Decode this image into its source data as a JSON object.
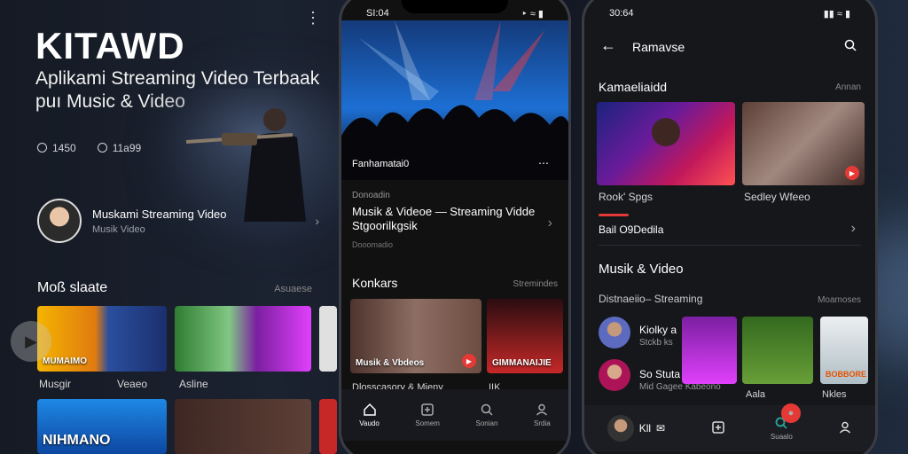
{
  "banner": {
    "title": "KITAWD",
    "subtitle": "Aplikami Streaming Video Terbaak puı Music & Video",
    "stats": [
      "1450",
      "11a99"
    ],
    "channel": {
      "name": "Muskami Streaming Video",
      "meta": "Musik Video"
    },
    "section": {
      "title": "Moß slaate",
      "more": "Asuaese"
    },
    "thumbs": [
      {
        "label": "MUMAIMO",
        "caption": "Musgir"
      },
      {
        "label": "",
        "caption": "Veaeo"
      },
      {
        "label": "",
        "caption": "Asline"
      },
      {
        "label": "",
        "caption": ""
      },
      {
        "label": "NIHMANO",
        "caption": ""
      }
    ]
  },
  "phone1": {
    "time": "SI:04",
    "hero_label": "Fanhamatai0",
    "meta_small": "Donoadin",
    "video_title": "Musik & Videoe — Streaming Vidde Stgoorilkgsik",
    "meta_small2": "Dooomadio",
    "section": {
      "title": "Konkars",
      "more": "Stremindes"
    },
    "cards": [
      {
        "label": "Musik & Vbdeos",
        "caption": "Dlosscasory & Mieny"
      },
      {
        "label": "GIMMANAIJIE",
        "caption": "IIK"
      }
    ],
    "tabs": [
      "Vaudo",
      "Somem",
      "Sonian",
      "Srdia"
    ]
  },
  "phone2": {
    "time": "30:64",
    "header_title": "Ramavse",
    "section1": {
      "title": "Kamaeliaidd",
      "more": "Annan"
    },
    "cards": [
      {
        "caption": "Rook' Spgs"
      },
      {
        "caption": "Sedley Wfeeo"
      }
    ],
    "link_row": "Bail O9Dedila",
    "section2_title": "Musik & Video",
    "section3": {
      "title": "Distnaeiio– Streaming",
      "more": "Moamoses"
    },
    "list": [
      {
        "title": "Kiolky a",
        "meta": "Stckb ks"
      },
      {
        "title": "So Stuta",
        "meta": "Mid Gagee Kabeono"
      }
    ],
    "grid_captions": [
      "Aala",
      "Nkles"
    ],
    "grid_label": "BOBBORE",
    "bottom_label": "Kll",
    "tabs": [
      "",
      "",
      "Suaalo",
      ""
    ]
  },
  "colors": {
    "accent": "#e53935",
    "background": "#111111"
  }
}
